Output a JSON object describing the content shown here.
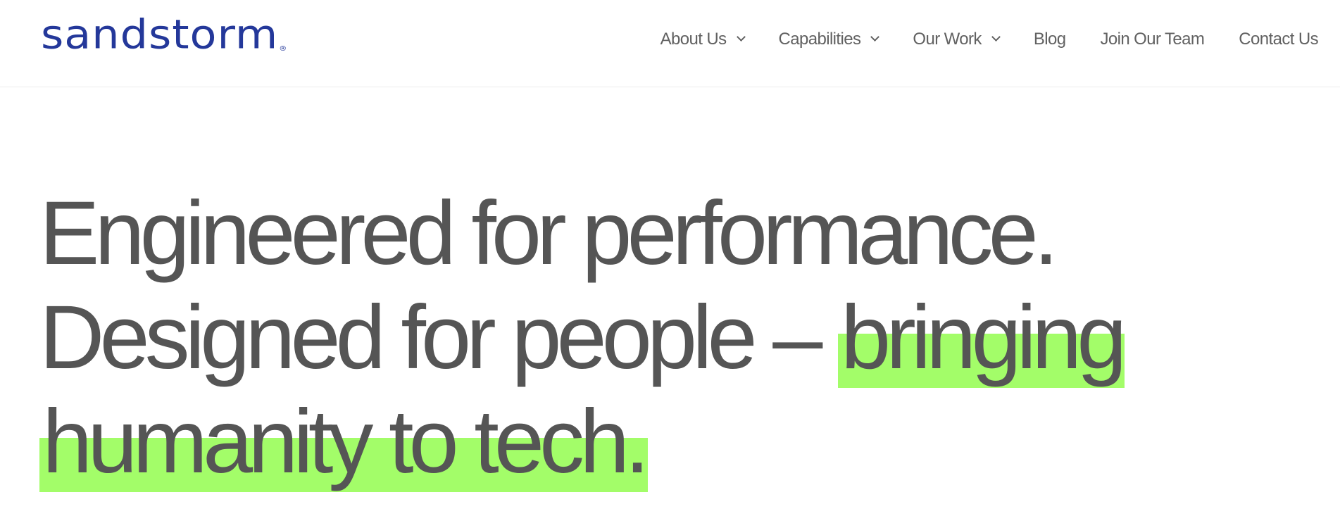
{
  "header": {
    "logo_text": "sandstorm",
    "logo_mark": "®",
    "brand_color": "#24389a",
    "nav": [
      {
        "label": "About Us",
        "has_dropdown": true,
        "icon": "chevron-down-icon"
      },
      {
        "label": "Capabilities",
        "has_dropdown": true,
        "icon": "chevron-down-icon"
      },
      {
        "label": "Our Work",
        "has_dropdown": true,
        "icon": "chevron-down-icon"
      },
      {
        "label": "Blog",
        "has_dropdown": false
      },
      {
        "label": "Join Our Team",
        "has_dropdown": false
      },
      {
        "label": "Contact Us",
        "has_dropdown": false
      }
    ]
  },
  "hero": {
    "line1": "Engineered for performance.",
    "line2_plain": "Designed for people – ",
    "line2_highlight": "bringing",
    "line3_highlight": "humanity to tech.",
    "text_color": "#555555",
    "highlight_color": "#a3fd69"
  }
}
